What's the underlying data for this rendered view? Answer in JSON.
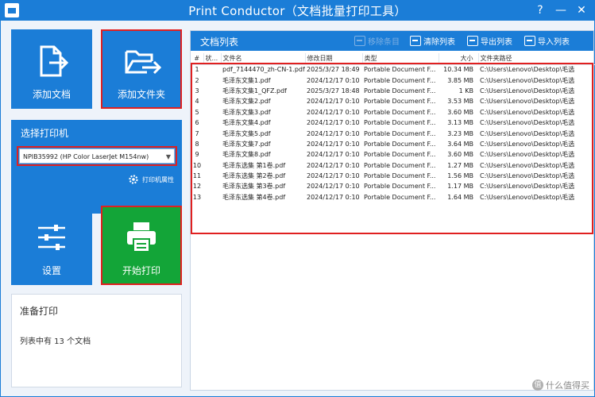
{
  "window": {
    "title": "Print Conductor（文档批量打印工具）",
    "help": "?",
    "minimize": "—",
    "close": "✕"
  },
  "tiles": {
    "add_doc": "添加文档",
    "add_folder": "添加文件夹",
    "settings": "设置",
    "start_print": "开始打印"
  },
  "printer": {
    "heading": "选择打印机",
    "selected": "NPIB35992 (HP Color LaserJet M154nw)",
    "properties": "打印机属性"
  },
  "status": {
    "title": "准备打印",
    "count_text": "列表中有 13 个文档"
  },
  "list": {
    "title": "文档列表",
    "toolbar": {
      "remove": "移除条目",
      "clear": "清除列表",
      "export": "导出列表",
      "import": "导入列表"
    },
    "columns": [
      "#",
      "状...",
      "文件名",
      "修改日期",
      "类型",
      "大小",
      "文件夹路径"
    ],
    "rows": [
      {
        "n": "1",
        "name": "pdf_7144470_zh-CN-1.pdf",
        "date": "2025/3/27 18:49",
        "type": "Portable Document F...",
        "size": "10.34 MB",
        "path": "C:\\Users\\Lenovo\\Desktop\\毛选"
      },
      {
        "n": "2",
        "name": "毛泽东文集1.pdf",
        "date": "2024/12/17 0:10",
        "type": "Portable Document F...",
        "size": "3.85 MB",
        "path": "C:\\Users\\Lenovo\\Desktop\\毛选"
      },
      {
        "n": "3",
        "name": "毛泽东文集1_QFZ.pdf",
        "date": "2025/3/27 18:48",
        "type": "Portable Document F...",
        "size": "1 KB",
        "path": "C:\\Users\\Lenovo\\Desktop\\毛选"
      },
      {
        "n": "4",
        "name": "毛泽东文集2.pdf",
        "date": "2024/12/17 0:10",
        "type": "Portable Document F...",
        "size": "3.53 MB",
        "path": "C:\\Users\\Lenovo\\Desktop\\毛选"
      },
      {
        "n": "5",
        "name": "毛泽东文集3.pdf",
        "date": "2024/12/17 0:10",
        "type": "Portable Document F...",
        "size": "3.60 MB",
        "path": "C:\\Users\\Lenovo\\Desktop\\毛选"
      },
      {
        "n": "6",
        "name": "毛泽东文集4.pdf",
        "date": "2024/12/17 0:10",
        "type": "Portable Document F...",
        "size": "3.13 MB",
        "path": "C:\\Users\\Lenovo\\Desktop\\毛选"
      },
      {
        "n": "7",
        "name": "毛泽东文集5.pdf",
        "date": "2024/12/17 0:10",
        "type": "Portable Document F...",
        "size": "3.23 MB",
        "path": "C:\\Users\\Lenovo\\Desktop\\毛选"
      },
      {
        "n": "8",
        "name": "毛泽东文集7.pdf",
        "date": "2024/12/17 0:10",
        "type": "Portable Document F...",
        "size": "3.64 MB",
        "path": "C:\\Users\\Lenovo\\Desktop\\毛选"
      },
      {
        "n": "9",
        "name": "毛泽东文集8.pdf",
        "date": "2024/12/17 0:10",
        "type": "Portable Document F...",
        "size": "3.60 MB",
        "path": "C:\\Users\\Lenovo\\Desktop\\毛选"
      },
      {
        "n": "10",
        "name": "毛泽东选集 第1卷.pdf",
        "date": "2024/12/17 0:10",
        "type": "Portable Document F...",
        "size": "1.27 MB",
        "path": "C:\\Users\\Lenovo\\Desktop\\毛选"
      },
      {
        "n": "11",
        "name": "毛泽东选集 第2卷.pdf",
        "date": "2024/12/17 0:10",
        "type": "Portable Document F...",
        "size": "1.56 MB",
        "path": "C:\\Users\\Lenovo\\Desktop\\毛选"
      },
      {
        "n": "12",
        "name": "毛泽东选集 第3卷.pdf",
        "date": "2024/12/17 0:10",
        "type": "Portable Document F...",
        "size": "1.17 MB",
        "path": "C:\\Users\\Lenovo\\Desktop\\毛选"
      },
      {
        "n": "13",
        "name": "毛泽东选集 第4卷.pdf",
        "date": "2024/12/17 0:10",
        "type": "Portable Document F...",
        "size": "1.64 MB",
        "path": "C:\\Users\\Lenovo\\Desktop\\毛选"
      }
    ]
  },
  "watermark": {
    "badge": "值",
    "text": "什么值得买"
  },
  "colors": {
    "accent": "#1b7dd7",
    "start_green": "#13a538",
    "highlight": "#e02020"
  }
}
